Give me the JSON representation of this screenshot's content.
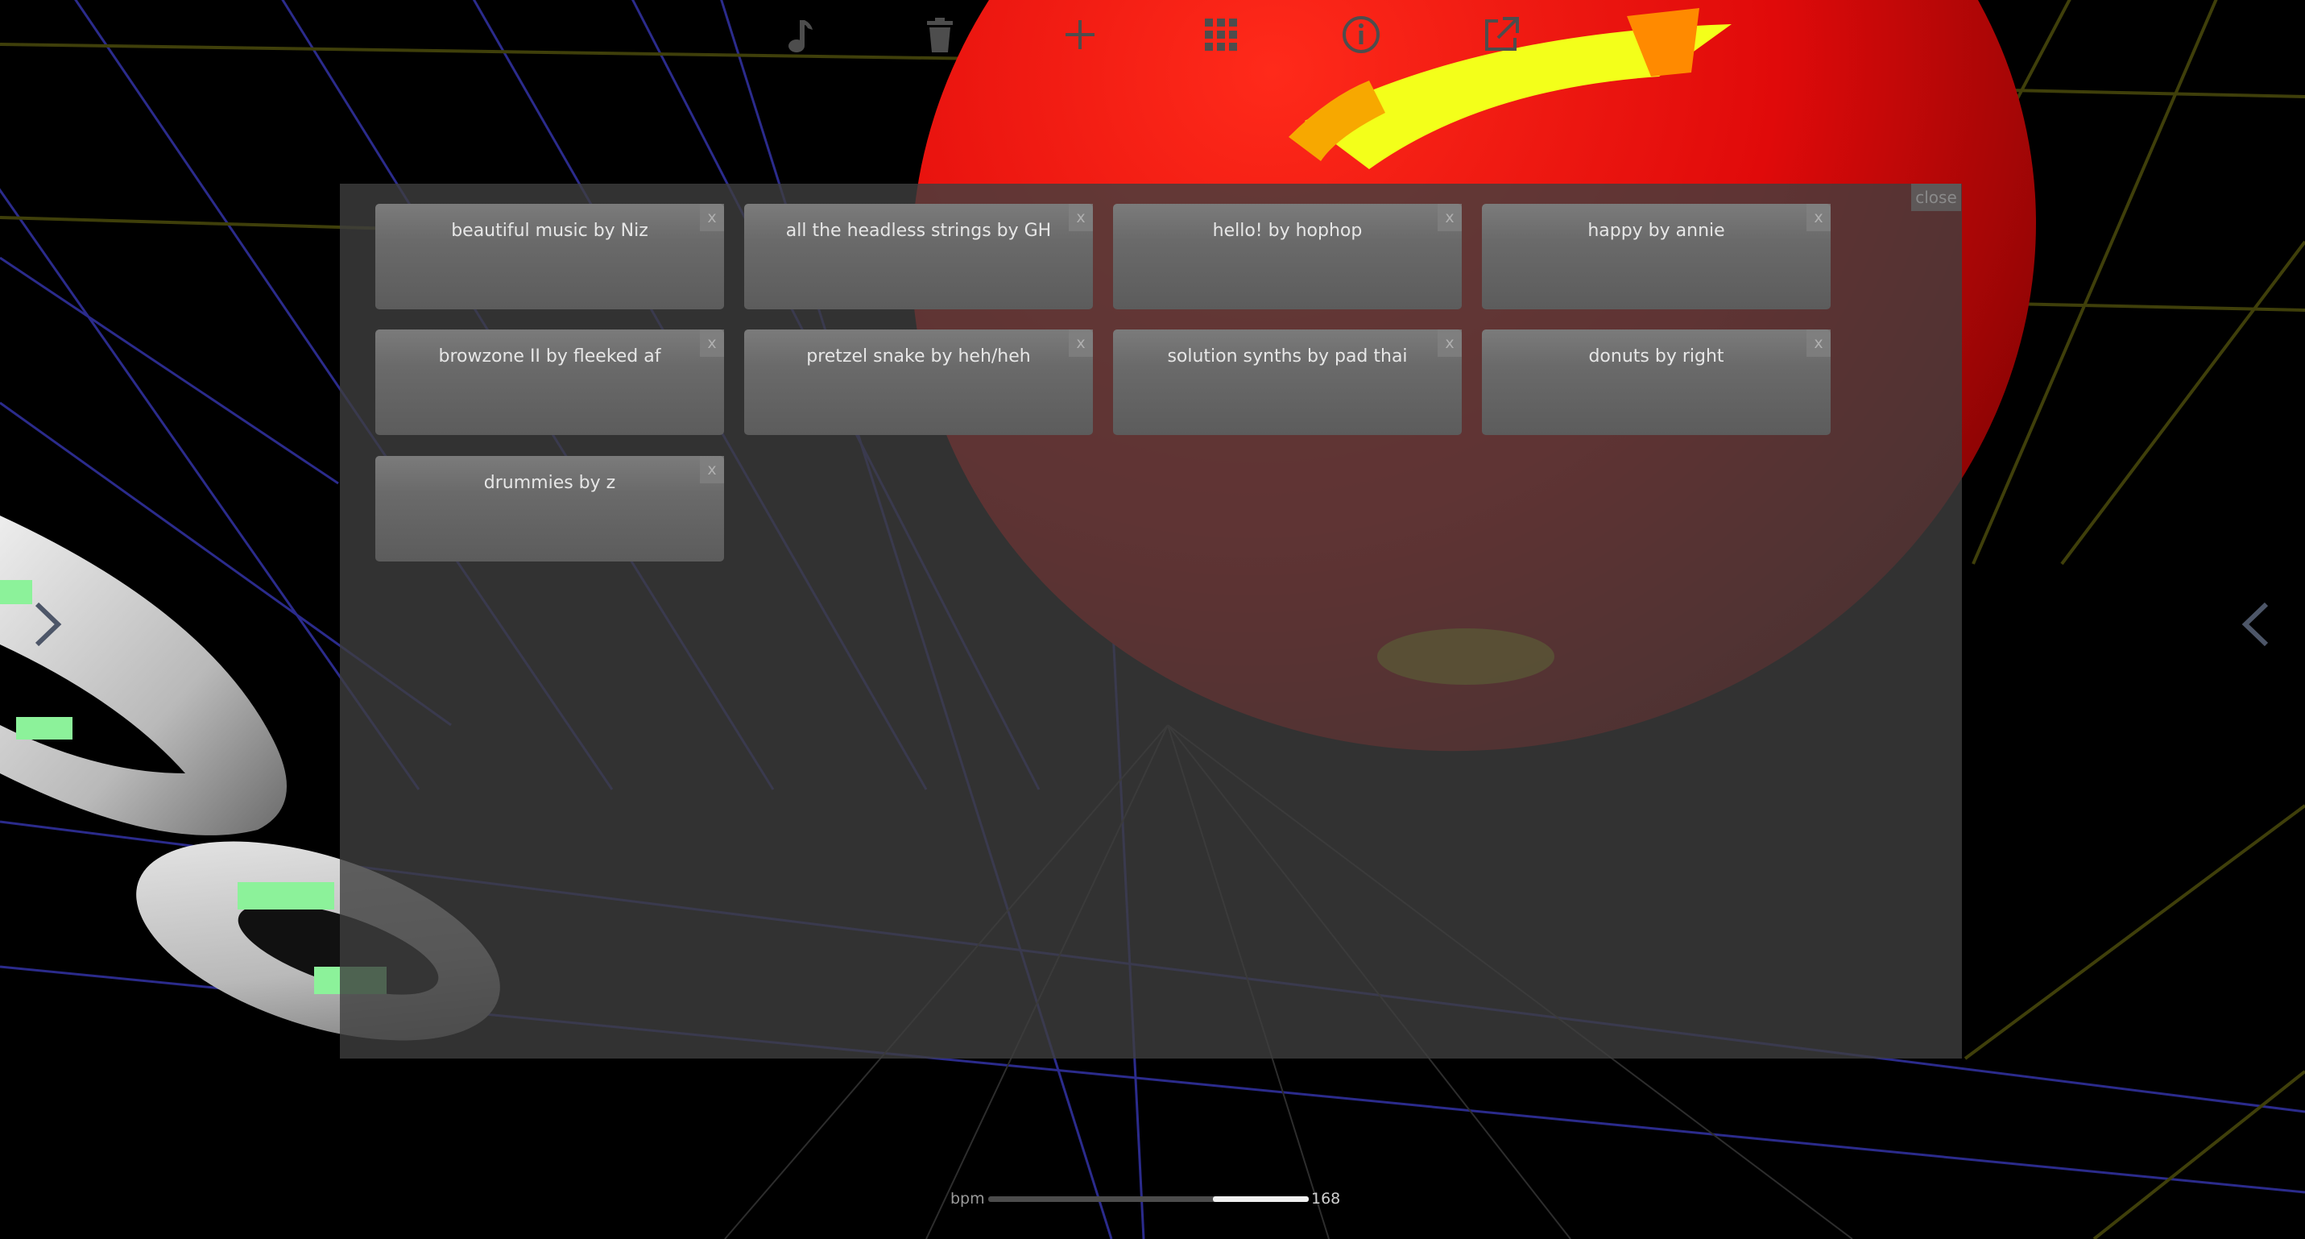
{
  "toolbar": {
    "items": [
      {
        "name": "music-note-icon"
      },
      {
        "name": "trash-icon"
      },
      {
        "name": "plus-icon"
      },
      {
        "name": "grid-icon"
      },
      {
        "name": "info-icon"
      },
      {
        "name": "share-icon"
      }
    ],
    "color": "#4d4d4d"
  },
  "nav": {
    "left": "chevron-right-icon",
    "right": "chevron-left-icon"
  },
  "modal": {
    "close_label": "close",
    "songs": [
      {
        "title": "beautiful music by Niz",
        "delete": "x"
      },
      {
        "title": "all the headless strings by GH",
        "delete": "x"
      },
      {
        "title": "hello! by hophop",
        "delete": "x"
      },
      {
        "title": "happy by annie",
        "delete": "x"
      },
      {
        "title": "browzone II by fleeked af",
        "delete": "x"
      },
      {
        "title": "pretzel snake by heh/heh",
        "delete": "x"
      },
      {
        "title": "solution synths by pad thai",
        "delete": "x"
      },
      {
        "title": "donuts by right",
        "delete": "x"
      },
      {
        "title": "drummies by z",
        "delete": "x"
      }
    ]
  },
  "bpm": {
    "label": "bpm",
    "value": "168",
    "fraction": 0.7
  },
  "colors": {
    "ring_white": "#d8d8d8",
    "ring_green": "#8cf29a",
    "sphere_red": "#e30a0a",
    "sphere_yellow": "#f3ff1a",
    "grid_blue": "#2b2b8c",
    "grid_olive": "#3f3f0a"
  }
}
